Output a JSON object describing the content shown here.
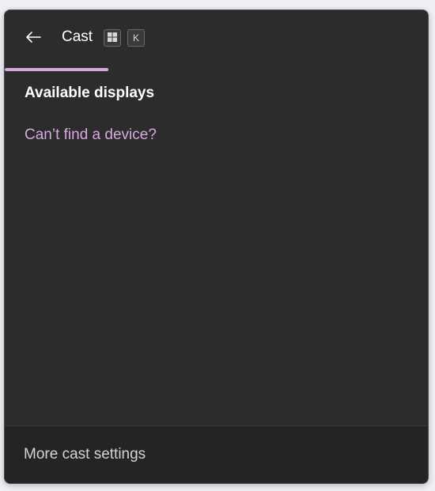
{
  "header": {
    "back_icon": "arrow-left-icon",
    "title": "Cast",
    "shortcut": {
      "win_key_icon": "windows-logo-icon",
      "key": "K"
    }
  },
  "progress": {
    "indeterminate": true,
    "color": "#d8a9e0"
  },
  "main": {
    "section_title": "Available displays",
    "help_link": "Can’t find a device?"
  },
  "footer": {
    "settings_link": "More cast settings"
  },
  "colors": {
    "panel_bg": "#2c2c2c",
    "accent": "#d8a9e0",
    "footer_bg": "#242424"
  }
}
